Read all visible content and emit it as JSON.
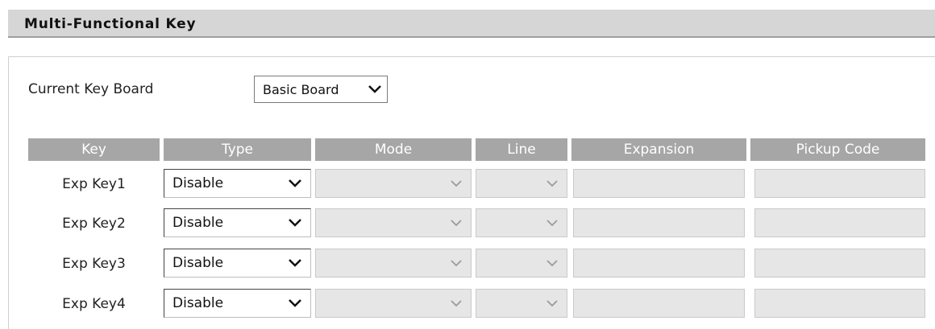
{
  "section": {
    "title": "Multi-Functional Key"
  },
  "keyboard": {
    "label": "Current Key Board",
    "selected": "Basic Board"
  },
  "table": {
    "headers": [
      "Key",
      "Type",
      "Mode",
      "Line",
      "Expansion",
      "Pickup Code"
    ],
    "rows": [
      {
        "key": "Exp Key1",
        "type": "Disable",
        "mode": "",
        "line": "",
        "expansion": "",
        "pickup_code": ""
      },
      {
        "key": "Exp Key2",
        "type": "Disable",
        "mode": "",
        "line": "",
        "expansion": "",
        "pickup_code": ""
      },
      {
        "key": "Exp Key3",
        "type": "Disable",
        "mode": "",
        "line": "",
        "expansion": "",
        "pickup_code": ""
      },
      {
        "key": "Exp Key4",
        "type": "Disable",
        "mode": "",
        "line": "",
        "expansion": "",
        "pickup_code": ""
      }
    ]
  },
  "colors": {
    "header_bg": "#d6d6d6",
    "column_header_bg": "#a6a6a6",
    "disabled_field_bg": "#e6e6e6"
  },
  "icons": {
    "dropdown": "chevron-down-icon"
  }
}
